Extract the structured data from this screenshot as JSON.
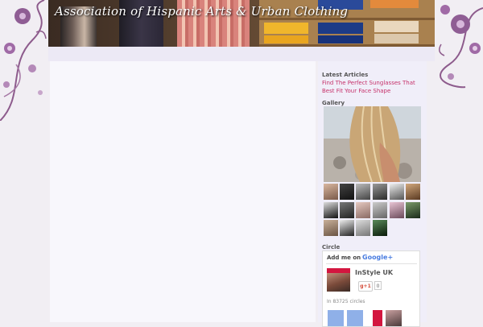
{
  "site": {
    "title": "Association of Hispanic Arts & Urban Clothing"
  },
  "sidebar": {
    "latest_articles": {
      "heading": "Latest Articles",
      "items": [
        {
          "label": "Find The Perfect Sunglasses That Best Fit Your Face Shape"
        }
      ]
    },
    "gallery": {
      "heading": "Gallery"
    },
    "circle": {
      "heading": "Circle",
      "add_me": "Add me on",
      "google_plus_logo": "Google+",
      "profile_name": "InStyle UK",
      "plus_one_label": "g+1",
      "plus_one_count": "0",
      "circles_text": "In 83725 circles"
    }
  },
  "colors": {
    "page_bg": "#f1eef3",
    "link": "#c6326b",
    "heading": "#555555",
    "title_text": "#ffffff"
  },
  "icons": [
    "floral-ornament-icon",
    "google-plus-logo-icon"
  ]
}
